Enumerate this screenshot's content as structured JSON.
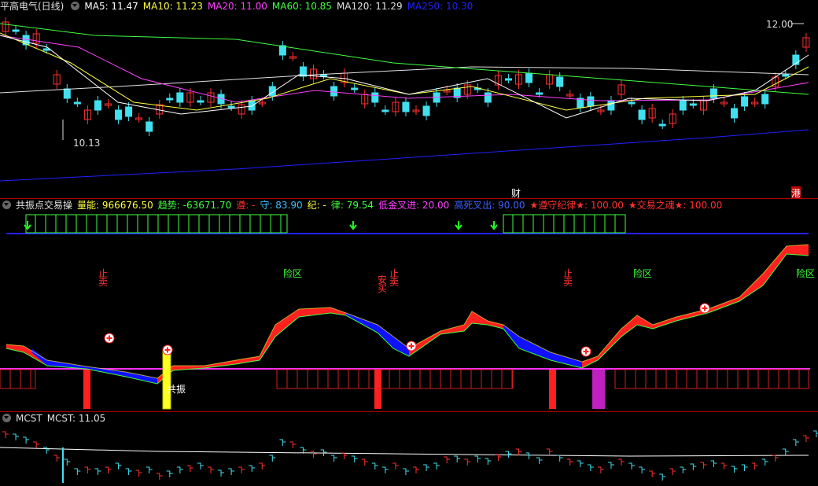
{
  "colors": {
    "up": "#ff3030",
    "down": "#40e0f0",
    "ma5": "#ffffff",
    "ma10": "#ffff40",
    "ma20": "#ff40ff",
    "ma60": "#40ff40",
    "ma120": "#e0e0e0",
    "ma250": "#2020ff",
    "panel_red": "#ff2020",
    "panel_blue": "#1010ff",
    "panel_magenta": "#ff30ff"
  },
  "main_pane": {
    "stock_name": "平高电气(日线)",
    "ma_labels": [
      {
        "text": "MA5: 11.47",
        "color": "#ffffff"
      },
      {
        "text": "MA10: 11.23",
        "color": "#ffff40"
      },
      {
        "text": "MA20: 11.00",
        "color": "#ff40ff"
      },
      {
        "text": "MA60: 10.85",
        "color": "#40ff40"
      },
      {
        "text": "MA120: 11.29",
        "color": "#e0e0e0"
      },
      {
        "text": "MA250: 10.30",
        "color": "#2020ff"
      }
    ],
    "high_marker": "12.00",
    "low_marker": "10.13",
    "event_caibao": "财",
    "event_gang": "港"
  },
  "indicator_pane": {
    "name": "共振点交易操",
    "labels": [
      {
        "text": "量能: 966676.50",
        "color": "#ffff40"
      },
      {
        "text": "趋势: -63671.70",
        "color": "#40ff40"
      },
      {
        "text": "遵: -",
        "color": "#ff3030"
      },
      {
        "text": "守: 83.90",
        "color": "#40c0ff"
      },
      {
        "text": "纪: -",
        "color": "#ffff40"
      },
      {
        "text": "律: 79.54",
        "color": "#40ff40"
      },
      {
        "text": "低金叉进: 20.00",
        "color": "#ff40ff"
      },
      {
        "text": "高死叉出: 90.00",
        "color": "#4060ff"
      },
      {
        "text": "★遵守纪律★: 100.00",
        "color": "#ff3030"
      },
      {
        "text": "★交易之魂★: 100.00",
        "color": "#ff3030"
      }
    ],
    "annotations": {
      "zhimai": "止卖",
      "xianqu": "险区",
      "anmai": "安买",
      "gongzhen": "共振"
    }
  },
  "mcst_pane": {
    "name": "MCST",
    "value_label": "MCST: 11.05"
  }
}
